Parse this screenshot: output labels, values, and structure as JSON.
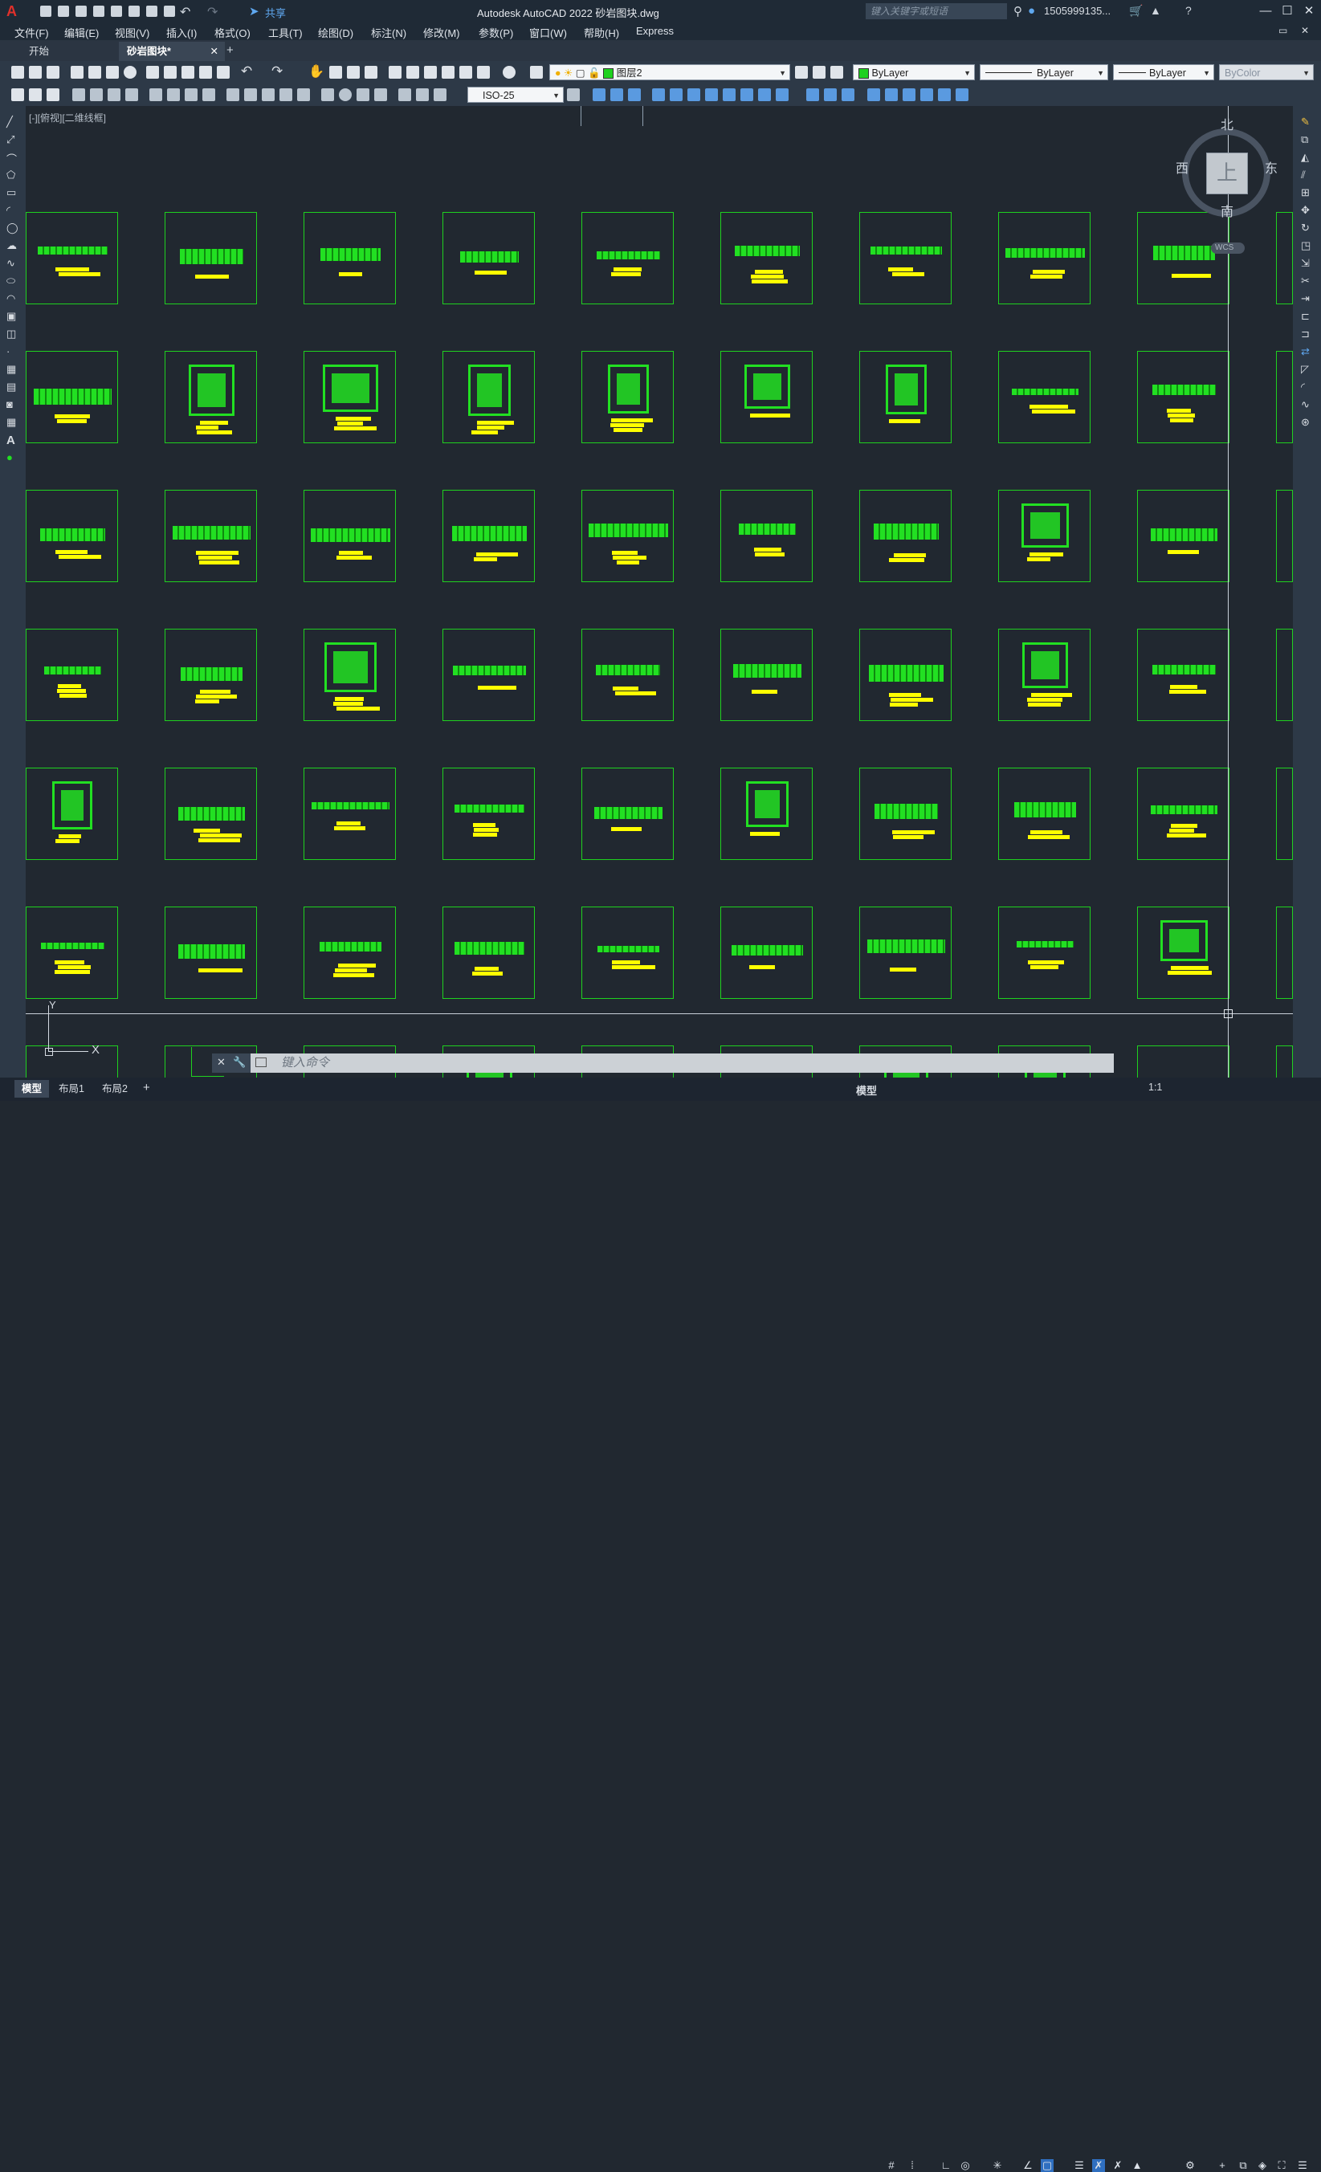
{
  "window": {
    "title": "Autodesk AutoCAD 2022    砂岩图块.dwg",
    "share": "共享",
    "search_placeholder": "键入关键字或短语",
    "user": "1505999135...",
    "minimize": "—",
    "maximize": "☐",
    "close": "✕"
  },
  "menu": [
    "文件(F)",
    "编辑(E)",
    "视图(V)",
    "插入(I)",
    "格式(O)",
    "工具(T)",
    "绘图(D)",
    "标注(N)",
    "修改(M)",
    "参数(P)",
    "窗口(W)",
    "帮助(H)",
    "Express"
  ],
  "doc_tabs": [
    {
      "label": "开始",
      "active": false
    },
    {
      "label": "砂岩图块*",
      "active": true
    }
  ],
  "toolbar": {
    "layer": "图层2",
    "color": "ByLayer",
    "linetype": "ByLayer",
    "lineweight": "ByLayer",
    "plotstyle": "ByColor",
    "dimstyle": "ISO-25"
  },
  "viewport": {
    "label": "[-][俯视][二维线框]",
    "compass": {
      "north": "北",
      "south": "南",
      "east": "东",
      "west": "西",
      "top": "上",
      "wcs": "WCS"
    },
    "ucs": {
      "x": "X",
      "y": "Y"
    }
  },
  "command_line": {
    "placeholder": "键入命令"
  },
  "layout_tabs": [
    {
      "label": "模型",
      "active": true
    },
    {
      "label": "布局1",
      "active": false
    },
    {
      "label": "布局2",
      "active": false
    }
  ],
  "status": {
    "model": "模型",
    "scale": "1:1"
  },
  "colors": {
    "block_border": "#1fd11f",
    "pattern": "#22e022",
    "label": "#ffff00",
    "background": "#212830"
  }
}
